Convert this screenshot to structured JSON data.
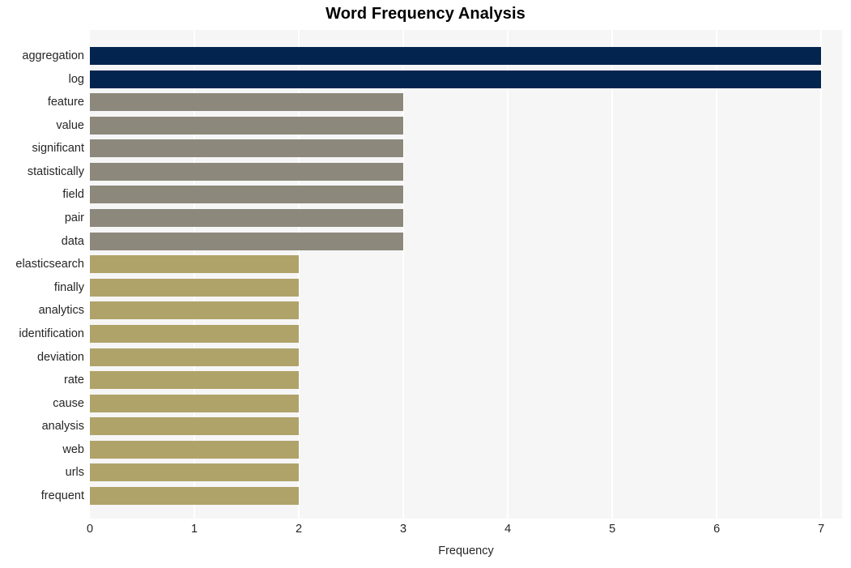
{
  "chart_data": {
    "type": "bar",
    "orientation": "horizontal",
    "title": "Word Frequency Analysis",
    "xlabel": "Frequency",
    "ylabel": "",
    "xlim": [
      0,
      7.2
    ],
    "xticks": [
      0,
      1,
      2,
      3,
      4,
      5,
      6,
      7
    ],
    "xtick_labels": [
      "0",
      "1",
      "2",
      "3",
      "4",
      "5",
      "6",
      "7"
    ],
    "grid": "vertical",
    "legend": null,
    "categories": [
      "aggregation",
      "log",
      "feature",
      "value",
      "significant",
      "statistically",
      "field",
      "pair",
      "data",
      "elasticsearch",
      "finally",
      "analytics",
      "identification",
      "deviation",
      "rate",
      "cause",
      "analysis",
      "web",
      "urls",
      "frequent"
    ],
    "values": [
      7,
      7,
      3,
      3,
      3,
      3,
      3,
      3,
      3,
      2,
      2,
      2,
      2,
      2,
      2,
      2,
      2,
      2,
      2,
      2
    ],
    "bar_colors": [
      "#042450",
      "#042450",
      "#8c897c",
      "#8c897c",
      "#8c897c",
      "#8c897c",
      "#8c897c",
      "#8c897c",
      "#8c897c",
      "#b0a36a",
      "#b0a36a",
      "#b0a36a",
      "#b0a36a",
      "#b0a36a",
      "#b0a36a",
      "#b0a36a",
      "#b0a36a",
      "#b0a36a",
      "#b0a36a",
      "#b0a36a"
    ]
  },
  "colors": {
    "plot_background": "#f6f6f7",
    "figure_background": "#ffffff",
    "gridline": "#ffffff",
    "text": "#262626",
    "title": "#000000",
    "accent_high": "#042450",
    "accent_mid": "#8c897c",
    "accent_low": "#b0a36a"
  }
}
